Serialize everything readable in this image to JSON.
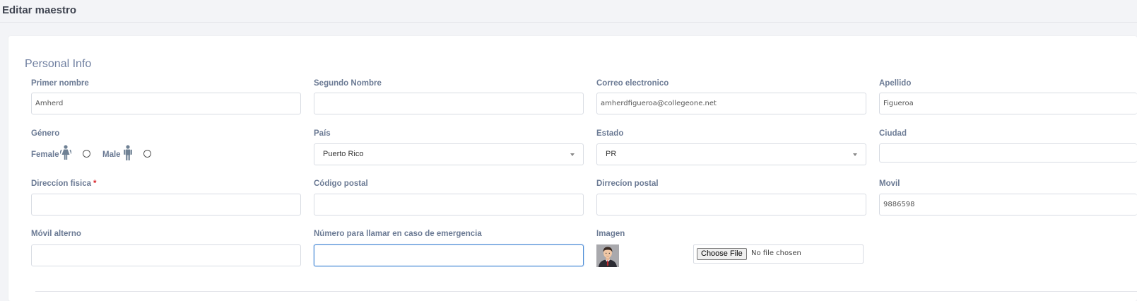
{
  "page": {
    "title": "Editar maestro"
  },
  "section": {
    "title": "Personal Info"
  },
  "fields": {
    "primer_nombre": {
      "label": "Primer nombre",
      "value": "Amherd"
    },
    "segundo_nombre": {
      "label": "Segundo Nombre",
      "value": ""
    },
    "correo": {
      "label": "Correo electronico",
      "value": "amherdfigueroa@collegeone.net"
    },
    "apellido": {
      "label": "Apellido",
      "value": "Figueroa"
    },
    "genero": {
      "label": "Género",
      "female": "Female",
      "male": "Male"
    },
    "pais": {
      "label": "País",
      "value": "Puerto Rico"
    },
    "estado": {
      "label": "Estado",
      "value": "PR"
    },
    "ciudad": {
      "label": "Ciudad",
      "value": ""
    },
    "direccion_fisica": {
      "label": "Direccíon fisica",
      "required_mark": "*",
      "value": ""
    },
    "codigo_postal": {
      "label": "Código postal",
      "value": ""
    },
    "direccion_postal": {
      "label": "Dirrecíon postal",
      "value": ""
    },
    "movil": {
      "label": "Movil",
      "value": "9886598"
    },
    "movil_alterno": {
      "label": "Móvil alterno",
      "value": ""
    },
    "emergencia": {
      "label": "Número para llamar en caso de emergencia",
      "value": ""
    },
    "imagen": {
      "label": "Imagen",
      "button": "Choose File",
      "status": "No file chosen"
    }
  },
  "colors": {
    "label": "#6b7a94",
    "focus_border": "#4a8bd6",
    "required": "#d9262c",
    "page_background": "#f3f4f7"
  },
  "icons": [
    "female-icon",
    "male-icon",
    "caret-down-icon",
    "avatar-image"
  ]
}
